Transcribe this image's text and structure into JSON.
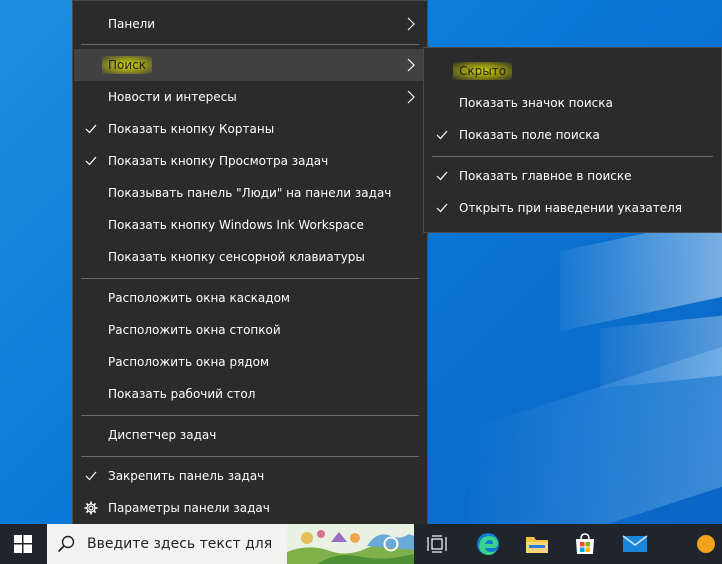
{
  "main_menu": {
    "items": [
      {
        "label": "Панели",
        "checked": false,
        "submenu": true
      },
      {
        "label": "Поиск",
        "checked": false,
        "submenu": true,
        "highlighted": true
      },
      {
        "label": "Новости и интересы",
        "checked": false,
        "submenu": true
      },
      {
        "label": "Показать кнопку Кортаны",
        "checked": true
      },
      {
        "label": "Показать кнопку Просмотра задач",
        "checked": true
      },
      {
        "label": "Показывать панель \"Люди\" на панели задач",
        "checked": false
      },
      {
        "label": "Показать кнопку Windows Ink Workspace",
        "checked": false
      },
      {
        "label": "Показать кнопку сенсорной клавиатуры",
        "checked": false
      },
      {
        "label": "Расположить окна каскадом",
        "checked": false
      },
      {
        "label": "Расположить окна стопкой",
        "checked": false
      },
      {
        "label": "Расположить окна рядом",
        "checked": false
      },
      {
        "label": "Показать рабочий стол",
        "checked": false
      },
      {
        "label": "Диспетчер задач",
        "checked": false
      },
      {
        "label": "Закрепить панель задач",
        "checked": true
      },
      {
        "label": "Параметры панели задач",
        "checked": false,
        "icon": "gear-icon"
      }
    ]
  },
  "search_submenu": {
    "items": [
      {
        "label": "Скрыто",
        "checked": false,
        "highlighted": true
      },
      {
        "label": "Показать значок поиска",
        "checked": false
      },
      {
        "label": "Показать поле поиска",
        "checked": true
      },
      {
        "label": "Показать главное в поиске",
        "checked": true
      },
      {
        "label": "Открыть при наведении указателя",
        "checked": true
      }
    ]
  },
  "taskbar": {
    "search_placeholder": "Введите здесь текст для",
    "icons": [
      "windows-start-icon",
      "search-icon",
      "cortana-icon",
      "task-view-icon",
      "edge-icon",
      "file-explorer-icon",
      "microsoft-store-icon",
      "mail-icon",
      "app-icon"
    ]
  },
  "colors": {
    "menu_bg": "#2b2b2b",
    "hover_bg": "#414141",
    "highlight": "#f2f200",
    "desktop": "#0a78d6",
    "taskbar": "#20252c"
  }
}
